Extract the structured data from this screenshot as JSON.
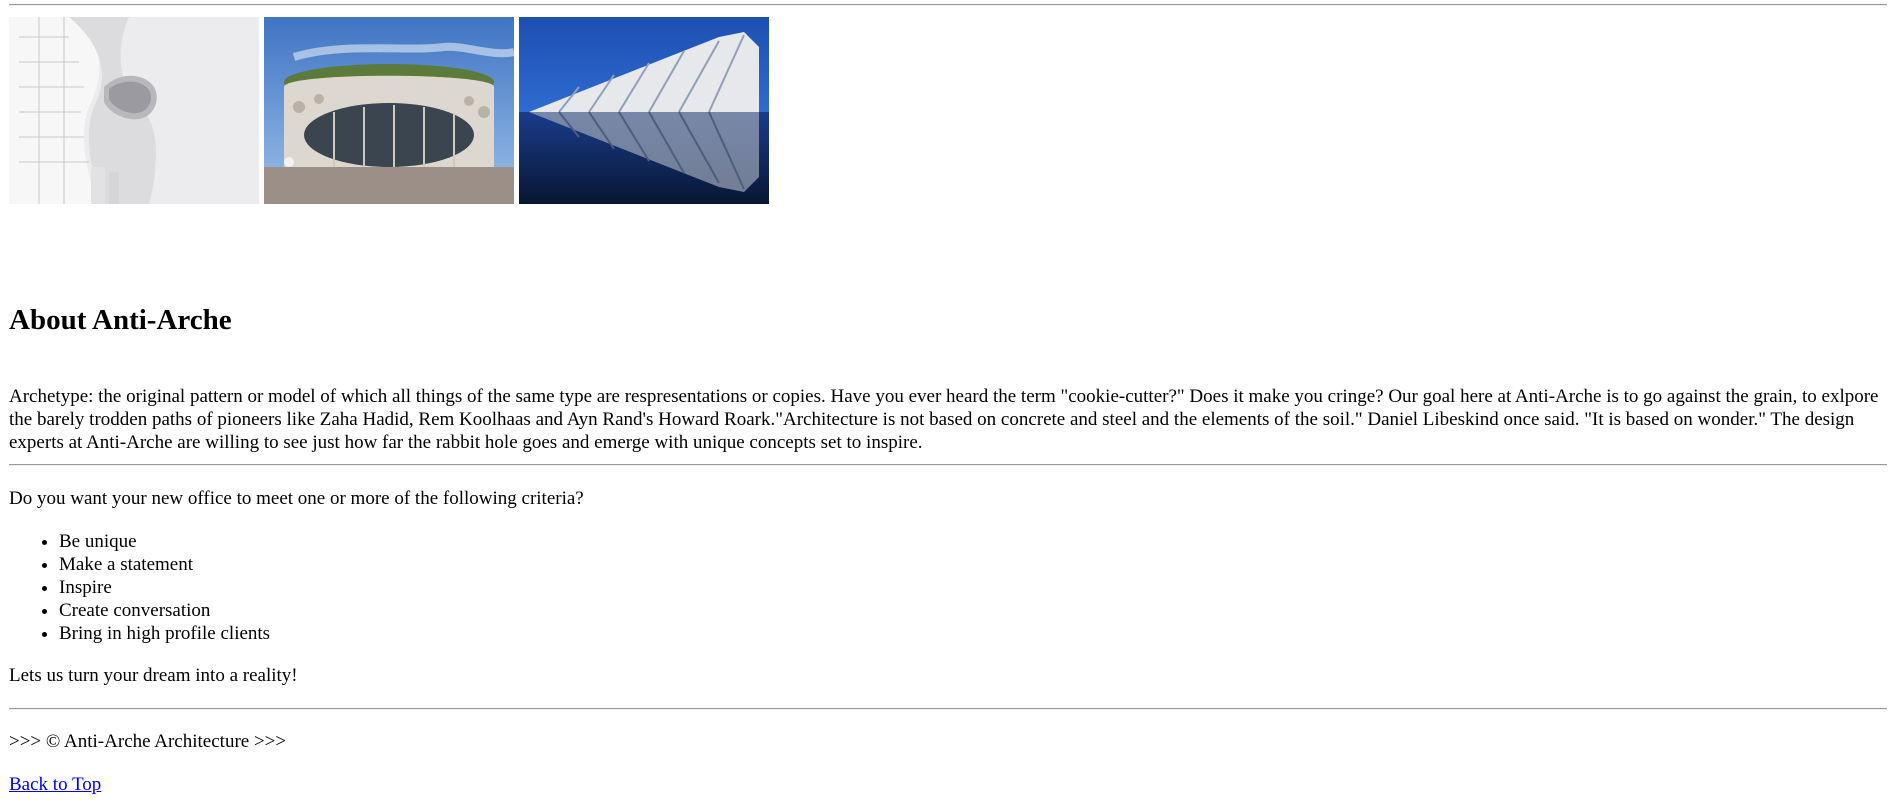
{
  "gallery": {
    "images": [
      {
        "name": "white curved building facade photo"
      },
      {
        "name": "round glass pavilion photo"
      },
      {
        "name": "white ribbed building over reflecting pool photo"
      }
    ]
  },
  "about": {
    "title": "About Anti-Arche",
    "text": "Archetype: the original pattern or model of which all things of the same type are respresentations or copies. Have you ever heard the term \"cookie-cutter?\" Does it make you cringe? Our goal here at Anti-Arche is to go against the grain, to exlpore the barely trodden paths of pioneers like Zaha Hadid, Rem Koolhaas and Ayn Rand's Howard Roark.\"Architecture is not based on concrete and steel and the elements of the soil.\" Daniel Libeskind once said. \"It is based on wonder.\" The design experts at Anti-Arche are willing to see just how far the rabbit hole goes and emerge with unique concepts set to inspire."
  },
  "criteria": {
    "intro": "Do you want your new office to meet one or more of the following criteria?",
    "items": [
      "Be unique",
      "Make a statement",
      "Inspire",
      "Create conversation",
      "Bring in high profile clients"
    ],
    "closing": "Lets us turn your dream into a reality!"
  },
  "footer": {
    "text": ">>> © Anti-Arche Architecture >>>",
    "back_to_top": "Back to Top"
  },
  "colors": {
    "link": "#0000ee",
    "rule": "#9a9a9a"
  }
}
